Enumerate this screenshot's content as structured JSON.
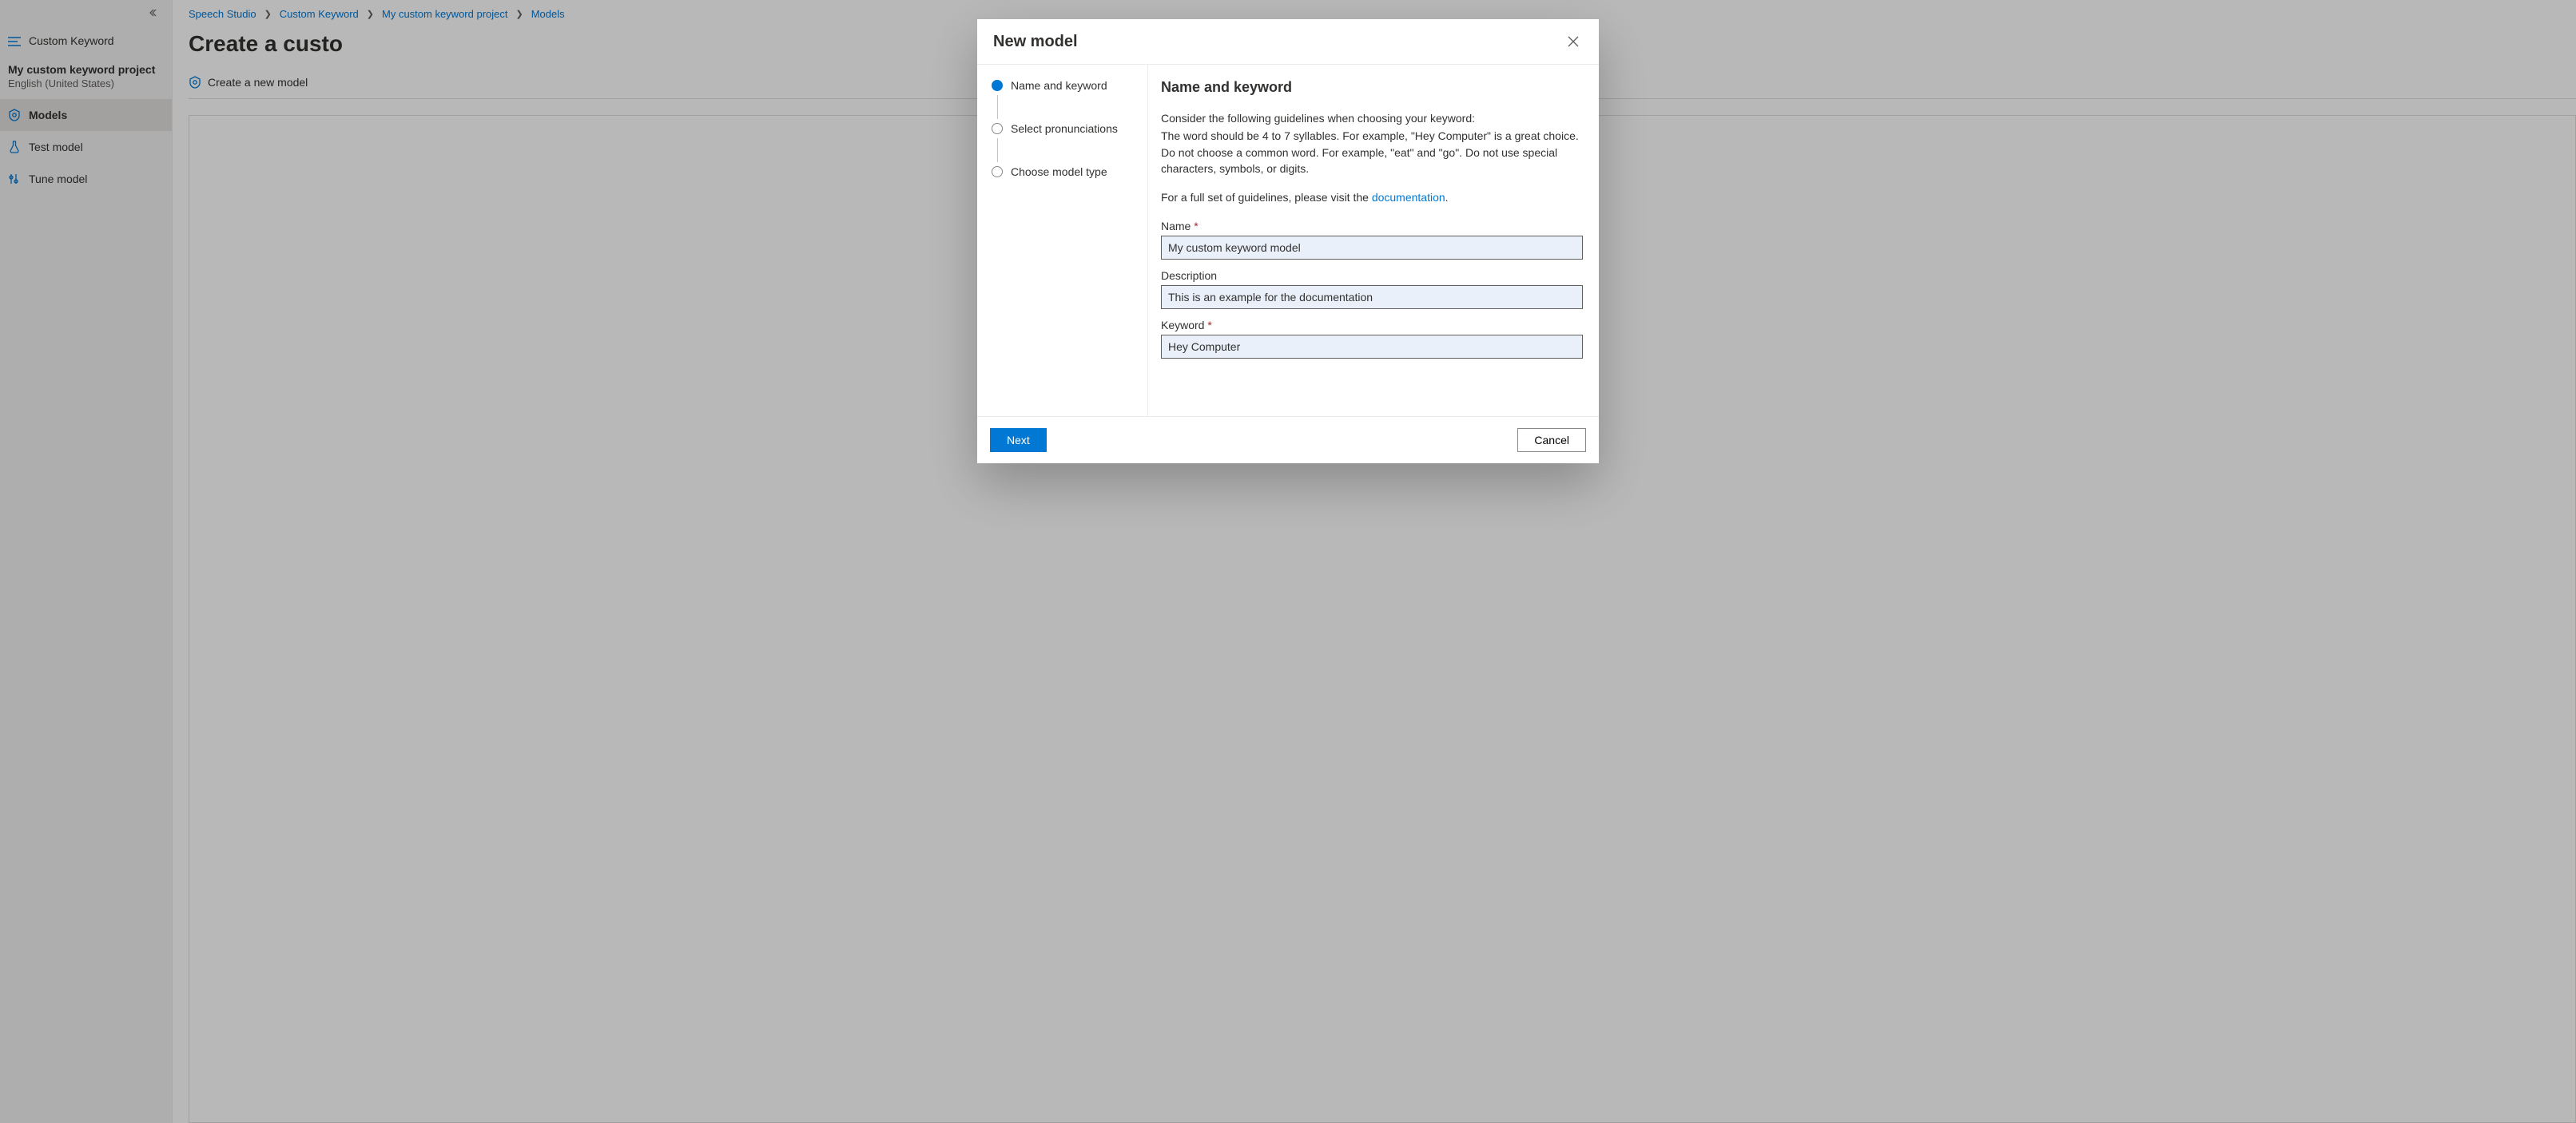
{
  "sidebar": {
    "header_label": "Custom Keyword",
    "project_name": "My custom keyword project",
    "language": "English (United States)",
    "items": [
      {
        "label": "Models"
      },
      {
        "label": "Test model"
      },
      {
        "label": "Tune model"
      }
    ]
  },
  "breadcrumb": {
    "items": [
      {
        "label": "Speech Studio"
      },
      {
        "label": "Custom Keyword"
      },
      {
        "label": "My custom keyword project"
      },
      {
        "label": "Models"
      }
    ]
  },
  "page": {
    "title_partial": "Create a custo",
    "subaction": "Create a new model"
  },
  "modal": {
    "title": "New model",
    "steps": [
      {
        "label": "Name and keyword"
      },
      {
        "label": "Select pronunciations"
      },
      {
        "label": "Choose model type"
      }
    ],
    "content": {
      "heading": "Name and keyword",
      "guidelines_intro": "Consider the following guidelines when choosing your keyword:",
      "guidelines_body": "The word should be 4 to 7 syllables. For example, \"Hey Computer\" is a great choice. Do not choose a common word. For example, \"eat\" and \"go\". Do not use special characters, symbols, or digits.",
      "doc_prefix": "For a full set of guidelines, please visit the ",
      "doc_link": "documentation",
      "doc_suffix": ".",
      "fields": {
        "name_label": "Name",
        "name_value": "My custom keyword model",
        "description_label": "Description",
        "description_value": "This is an example for the documentation",
        "keyword_label": "Keyword",
        "keyword_value": "Hey Computer"
      }
    },
    "buttons": {
      "next": "Next",
      "cancel": "Cancel"
    }
  }
}
